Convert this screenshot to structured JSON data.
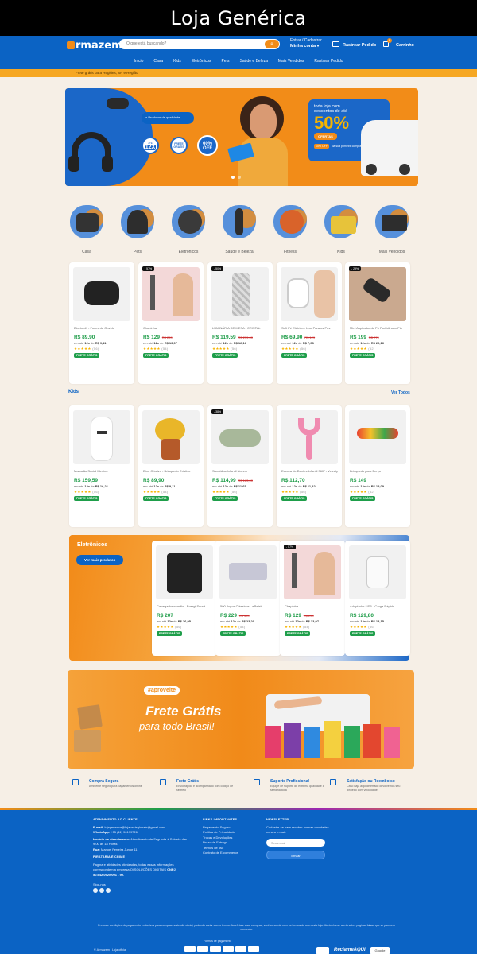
{
  "page_title": "Loja Genérica",
  "header": {
    "logo": "rmazem",
    "search_placeholder": "O que está buscando?",
    "login_line1": "Entrar / Cadastrar",
    "login_line2": "Minha conta",
    "track_order": "Rastrear Pedido",
    "cart": "Carrinho",
    "cart_count": "0"
  },
  "nav": [
    "Início",
    "Casa",
    "Kids",
    "Eletrônicos",
    "Pets",
    "Saúde e Beleza",
    "Mais Vendidos",
    "Rastrear Pedido"
  ],
  "notice": "Frete grátis para Regiões, SP e Região",
  "banner": {
    "search_label": "Produtos de qualidade",
    "badge_installments_top": "ATÉ",
    "badge_installments": "12X",
    "badge_shipping": "FRETE GRÁTIS",
    "badge_discount": "60% OFF",
    "promo_line1": "toda loja com",
    "promo_line2": "descontos de até",
    "promo_pct": "50%",
    "promo_btn": "OFERTAS",
    "promo_small": "Na sua primeira compra",
    "promo_small_pct": "10% OFF"
  },
  "categories": [
    "Casa",
    "Pets",
    "Eletrônicos",
    "Saúde e Beleza",
    "Fitness",
    "Kids",
    "Mais Vendidos"
  ],
  "products_row1": [
    {
      "name": "Bluetooth - Fones de Ouvido",
      "price": "R$ 89,90",
      "old": "",
      "inst": "12x",
      "inst_val": "R$ 9,11",
      "stars": "★★★★★",
      "reviews": "(56)",
      "ship": "FRETE GRÁTIS",
      "badge": ""
    },
    {
      "name": "Chapinha",
      "price": "R$ 129",
      "old": "R$ 259",
      "inst": "12x",
      "inst_val": "R$ 13,07",
      "stars": "★★★★★",
      "reviews": "(54)",
      "ship": "FRETE GRÁTIS",
      "badge": "- 57%"
    },
    {
      "name": "LUMINÁRIA DE MESA - CRISTAL",
      "price": "R$ 119,59",
      "old": "R$ 239,00",
      "inst": "12x",
      "inst_val": "R$ 12,16",
      "stars": "★★★★★",
      "reviews": "(56)",
      "ship": "FRETE GRÁTIS",
      "badge": "- 50%"
    },
    {
      "name": "Soft Pé Elétrico - Lixa Para os Pés",
      "price": "R$ 69,90",
      "old": "R$ 129",
      "inst": "12x",
      "inst_val": "R$ 7,08",
      "stars": "★★★★★",
      "reviews": "(56)",
      "ship": "FRETE GRÁTIS",
      "badge": ""
    },
    {
      "name": "Mini Aspirador de Pó Portátil sem Fio",
      "price": "R$ 199",
      "old": "R$ 279",
      "inst": "12x",
      "inst_val": "R$ 20,16",
      "stars": "★★★★★",
      "reviews": "(52)",
      "ship": "FRETE GRÁTIS",
      "badge": "- 29%"
    }
  ],
  "kids_section": {
    "title": "Kids",
    "see_all": "Ver Todos"
  },
  "products_kids": [
    {
      "name": "Macacão Social Menino",
      "price": "R$ 159,59",
      "old": "",
      "inst": "12x",
      "inst_val": "R$ 16,21",
      "stars": "★★★★★",
      "reviews": "(56)",
      "ship": "FRETE GRÁTIS",
      "badge": ""
    },
    {
      "name": "Dino Criativo - Brinquedo Criativo",
      "price": "R$ 89,90",
      "old": "",
      "inst": "12x",
      "inst_val": "R$ 9,11",
      "stars": "★★★★★",
      "reviews": "(54)",
      "ship": "FRETE GRÁTIS",
      "badge": ""
    },
    {
      "name": "Sandálias Infantil Nuvem",
      "price": "R$ 114,99",
      "old": "R$ 183,00",
      "inst": "12x",
      "inst_val": "R$ 11,65",
      "stars": "★★★★★",
      "reviews": "(56)",
      "ship": "FRETE GRÁTIS",
      "badge": "- 38%"
    },
    {
      "name": "Escova de Dentes Infantil 360º - Velvety",
      "price": "R$ 112,70",
      "old": "",
      "inst": "12x",
      "inst_val": "R$ 11,42",
      "stars": "★★★★★",
      "reviews": "(56)",
      "ship": "FRETE GRÁTIS",
      "badge": ""
    },
    {
      "name": "Brinquedo para Berço",
      "price": "R$ 149",
      "old": "",
      "inst": "12x",
      "inst_val": "R$ 15,09",
      "stars": "★★★★★",
      "reviews": "(52)",
      "ship": "FRETE GRÁTIS",
      "badge": ""
    }
  ],
  "electronics": {
    "title": "Eletrônicos",
    "button": "Ver mais produtos",
    "products": [
      {
        "name": "Carregador sem fio - Energi Smart",
        "price": "R$ 207",
        "old": "",
        "inst": "12x",
        "inst_val": "R$ 26,95",
        "stars": "★★★★★",
        "reviews": "(56)",
        "ship": "FRETE GRÁTIS",
        "badge": ""
      },
      {
        "name": "500 Jogos Clássicos - eRetrô",
        "price": "R$ 229",
        "old": "R$ 389",
        "inst": "12x",
        "inst_val": "R$ 23,20",
        "stars": "★★★★★",
        "reviews": "(54)",
        "ship": "FRETE GRÁTIS",
        "badge": ""
      },
      {
        "name": "Chapinha",
        "price": "R$ 129",
        "old": "R$ 259",
        "inst": "12x",
        "inst_val": "R$ 13,07",
        "stars": "★★★★★",
        "reviews": "(54)",
        "ship": "FRETE GRÁTIS",
        "badge": "- 57%"
      },
      {
        "name": "Adaptador USB - Carga Rápida",
        "price": "R$ 129,80",
        "old": "",
        "inst": "12x",
        "inst_val": "R$ 13,15",
        "stars": "★★★★★",
        "reviews": "(56)",
        "ship": "FRETE GRÁTIS",
        "badge": ""
      }
    ]
  },
  "frete": {
    "tag": "#aproveite",
    "line1": "Frete Grátis",
    "line2": "para todo Brasil!"
  },
  "features": [
    {
      "title": "Compra Segura",
      "desc": "Ambiente seguro para pagamentos online"
    },
    {
      "title": "Frete Grátis",
      "desc": "Envio rápido e acompanhado com código de rastreio"
    },
    {
      "title": "Suporte Profissional",
      "desc": "Equipe de suporte de extrema qualidade a semana toda"
    },
    {
      "title": "Satisfação ou Reembolso",
      "desc": "Caso haja algo de errado devolvemos seu dinheiro com velocidade"
    }
  ],
  "footer": {
    "col1_title": "ATENDIMENTO AO CLIENTE",
    "email_label": "E-mail:",
    "email": "lojagenerica@lojaoasisglobais@gmail.com",
    "whatsapp_label": "WhatsApp:",
    "whatsapp": "+55 (11) 96199726",
    "hours_label": "Horário de atendimento:",
    "hours": "Atendimento de Segunda à Sábado das 9:00 às 18 Horas",
    "address_label": "Rua:",
    "address": "Manoel Ferreira Junior 11",
    "company_label": "PIRATARIA É CRIME",
    "company_text": "Pagina e atividades otimizadas, todas essas informações correspondem a empresa Oi SOLUÇÕES DIGITAIS",
    "cnpj": "CNPJ 50.642.092/0001 - 90.",
    "social_label": "Siga-nos",
    "col2_title": "LINKS IMPORTANTES",
    "links": [
      "Pagamento Seguro",
      "Política de Privacidade",
      "Trocas e Devoluções",
      "Prazo de Entrega",
      "Termos de uso",
      "Contrato de E-commerce"
    ],
    "col3_title": "NEWSLETTER",
    "newsletter_text": "Cadastre-se para receber nossas novidades no seu e-mail.",
    "newsletter_placeholder": "Seu e-mail",
    "newsletter_btn": "Enviar",
    "legal": "Preços e condições de pagamento exclusivos para compras neste site oficial, podendo variar com o tempo. Ao efetuar suas compras, você concorda com os termos de uso desta loja. Mantenha-se alerta sobre páginas falsas que se parecem com esta.",
    "payment_label": "Formas de pagamento",
    "copyright": "© Armazem | Loja oficial",
    "seal1": "ReclameAQUI",
    "seal2": "Google"
  }
}
